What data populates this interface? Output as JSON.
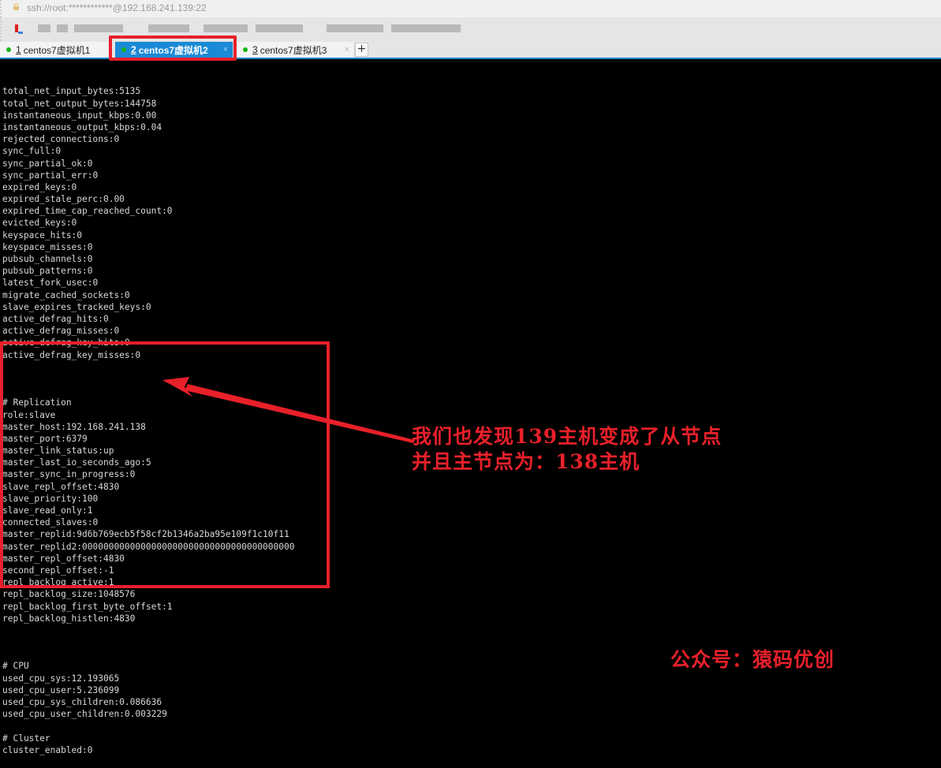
{
  "window": {
    "address": "ssh://root:************@192.168.241.139:22"
  },
  "tabs": [
    {
      "number": "1",
      "label": "centos7虚拟机1",
      "active": false,
      "status_color": "#18b318"
    },
    {
      "number": "2",
      "label": "centos7虚拟机2",
      "active": true,
      "status_color": "#18b318"
    },
    {
      "number": "3",
      "label": "centos7虚拟机3",
      "active": false,
      "status_color": "#18b318"
    }
  ],
  "tab_add_label": "+",
  "tab_close_glyph": "×",
  "terminal": {
    "stats_lines": [
      "total_net_input_bytes:5135",
      "total_net_output_bytes:144758",
      "instantaneous_input_kbps:0.00",
      "instantaneous_output_kbps:0.04",
      "rejected_connections:0",
      "sync_full:0",
      "sync_partial_ok:0",
      "sync_partial_err:0",
      "expired_keys:0",
      "expired_stale_perc:0.00",
      "expired_time_cap_reached_count:0",
      "evicted_keys:0",
      "keyspace_hits:0",
      "keyspace_misses:0",
      "pubsub_channels:0",
      "pubsub_patterns:0",
      "latest_fork_usec:0",
      "migrate_cached_sockets:0",
      "slave_expires_tracked_keys:0",
      "active_defrag_hits:0",
      "active_defrag_misses:0",
      "active_defrag_key_hits:0",
      "active_defrag_key_misses:0",
      ""
    ],
    "replication_lines": [
      "# Replication",
      "role:slave",
      "master_host:192.168.241.138",
      "master_port:6379",
      "master_link_status:up",
      "master_last_io_seconds_ago:5",
      "master_sync_in_progress:0",
      "slave_repl_offset:4830",
      "slave_priority:100",
      "slave_read_only:1",
      "connected_slaves:0",
      "master_replid:9d6b769ecb5f58cf2b1346a2ba95e109f1c10f11",
      "master_replid2:0000000000000000000000000000000000000000",
      "master_repl_offset:4830",
      "second_repl_offset:-1",
      "repl_backlog_active:1",
      "repl_backlog_size:1048576",
      "repl_backlog_first_byte_offset:1",
      "repl_backlog_histlen:4830",
      ""
    ],
    "cpu_lines": [
      "# CPU",
      "used_cpu_sys:12.193065",
      "used_cpu_user:5.236099",
      "used_cpu_sys_children:0.086636",
      "used_cpu_user_children:0.003229",
      "",
      "# Cluster",
      "cluster_enabled:0"
    ]
  },
  "annotation": {
    "line1": "我们也发现139主机变成了从节点",
    "line2": "并且主节点为：138主机",
    "color": "#e8202a"
  },
  "watermark": "公众号：猿码优创"
}
